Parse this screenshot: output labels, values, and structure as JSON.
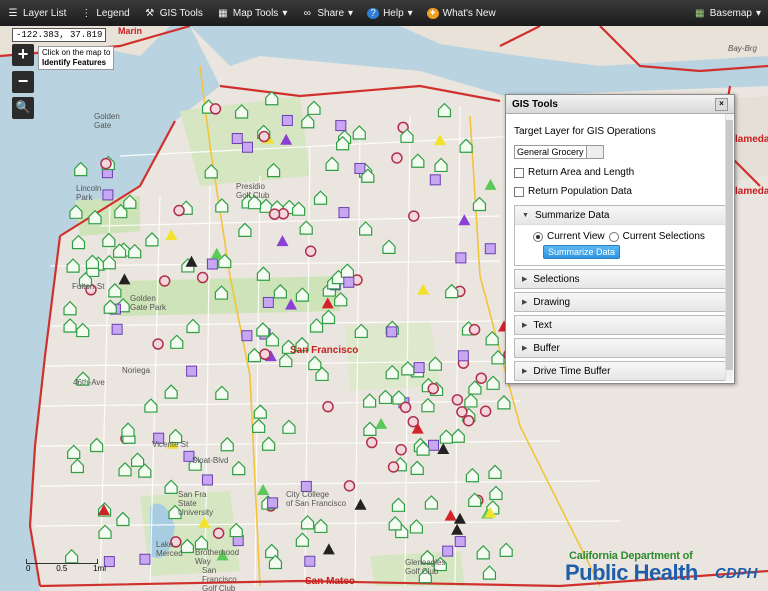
{
  "toolbar": {
    "layer_list": "Layer List",
    "legend": "Legend",
    "gis_tools": "GIS Tools",
    "map_tools": "Map Tools",
    "share": "Share",
    "help": "Help",
    "whats_new": "What's New",
    "basemap": "Basemap"
  },
  "map": {
    "coordinates": "-122.383, 37.819",
    "identify_hint": "Click on the map to",
    "identify_strong": "Identify Features",
    "zoom_in": "+",
    "zoom_out": "−",
    "labels": {
      "marin": "Marin",
      "golden_gate": "Golden\nGate",
      "san_francisco": "San Francisco",
      "san_mateo": "San Mateo",
      "alameda": "lameda",
      "presidio": "Presidio\nGolf Club",
      "lincoln_park": "Lincoln\nPark",
      "fulton": "Fulton-St",
      "noriega": "Noriega",
      "ave46": "46th-Ave",
      "sloat": "Sloat-Blvd",
      "vicente": "Vicente St",
      "sfstate": "San Fra\nState\nUniversity",
      "ccsf": "City College\nof San Francisco",
      "glen": "Gleneagles\nGolf Club",
      "brotherhood": "Brotherhood\nWay",
      "sfgolf": "San\nFrancisco\nGolf Club",
      "lake": "Lake\nMerced",
      "baybridge": "Bay-Brg",
      "golden_park": "Golden\nGate Park"
    },
    "scale": {
      "zero": "0",
      "half": "0.5",
      "one": "1mi"
    }
  },
  "panel": {
    "title": "GIS Tools",
    "close": "×",
    "target_label": "Target Layer for GIS Operations",
    "target_value": "General Grocery",
    "return_area": "Return Area and Length",
    "return_pop": "Return Population Data",
    "summarize_header": "Summarize Data",
    "current_view": "Current View",
    "current_selections": "Current Selections",
    "summarize_button": "Summarize Data",
    "sections": [
      "Selections",
      "Drawing",
      "Text",
      "Buffer",
      "Drive Time Buffer"
    ]
  },
  "logo": {
    "line1": "California Department of",
    "line2": "Public Health",
    "mark": "CDPH"
  },
  "colors": {
    "facility_green": "#2f9e44",
    "facility_purple": "#8b3fd6",
    "facility_red": "#d2232a",
    "facility_yellow": "#f2e22a",
    "boundary_red": "#d0312d"
  }
}
